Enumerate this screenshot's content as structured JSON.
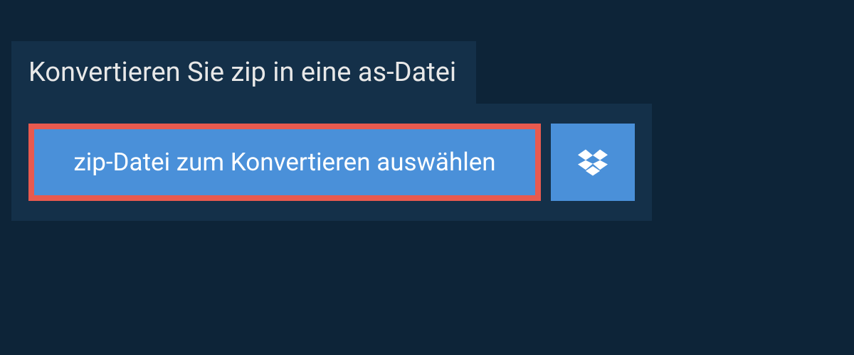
{
  "header": {
    "title": "Konvertieren Sie zip in eine as-Datei"
  },
  "actions": {
    "select_file_label": "zip-Datei zum Konvertieren auswählen",
    "dropbox_icon": "dropbox"
  },
  "colors": {
    "background": "#0d2438",
    "panel": "#143049",
    "button_primary": "#4a90d9",
    "button_border_highlight": "#e85a4f"
  }
}
